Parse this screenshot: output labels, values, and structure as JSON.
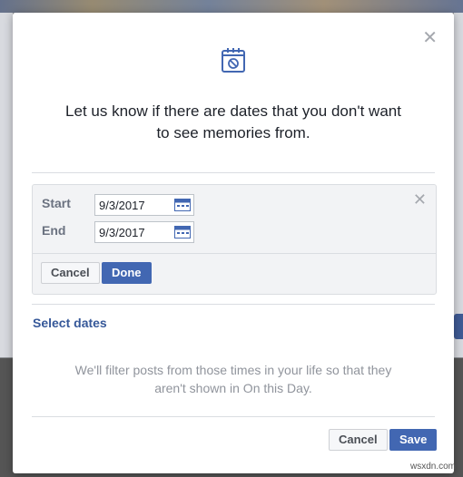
{
  "dialog": {
    "heading_line1": "Let us know if there are dates that you don't want",
    "heading_line2": "to see memories from.",
    "close_icon": "close-icon",
    "header_icon": "calendar-block-icon"
  },
  "date_panel": {
    "start_label": "Start",
    "start_value": "9/3/2017",
    "end_label": "End",
    "end_value": "9/3/2017",
    "cancel_label": "Cancel",
    "done_label": "Done"
  },
  "select_dates_label": "Select dates",
  "description_line1": "We'll filter posts from those times in your life so that they",
  "description_line2": "aren't shown in On this Day.",
  "footer": {
    "cancel_label": "Cancel",
    "save_label": "Save"
  },
  "watermark": "wsxdn.com",
  "colors": {
    "primary": "#4267b2",
    "link": "#365899",
    "text": "#1d2129",
    "muted": "#90949c"
  }
}
